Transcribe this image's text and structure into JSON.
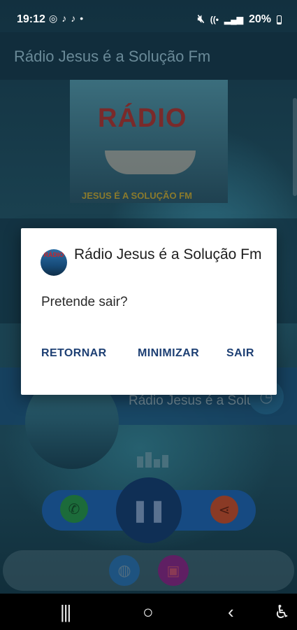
{
  "status_bar": {
    "time": "19:12",
    "battery": "20%",
    "left_icons": [
      "whatsapp-icon",
      "tiktok-icon",
      "tiktok-icon",
      "dot"
    ],
    "right_icons": [
      "mute-icon",
      "wifi-icon",
      "signal-icon",
      "signal-icon",
      "battery-icon"
    ]
  },
  "app": {
    "title": "Rádio Jesus é a Solução Fm",
    "art_title": "RÁDIO",
    "art_subtitle": "JESUS É A SOLUÇÃO FM"
  },
  "player": {
    "station_name": "Rádio Jesus é a Solução Fm",
    "state": "playing"
  },
  "dialog": {
    "title": "Rádio Jesus é a Solução Fm",
    "message": "Pretende sair?",
    "icon_label": "RÁDIO",
    "buttons": {
      "return": "RETORNAR",
      "minimize": "MINIMIZAR",
      "exit": "SAIR"
    }
  },
  "colors": {
    "accent": "#1d3f73",
    "dialog_bg": "#ffffff",
    "whatsapp": "#1c6b3a",
    "share": "#8a3a25"
  }
}
